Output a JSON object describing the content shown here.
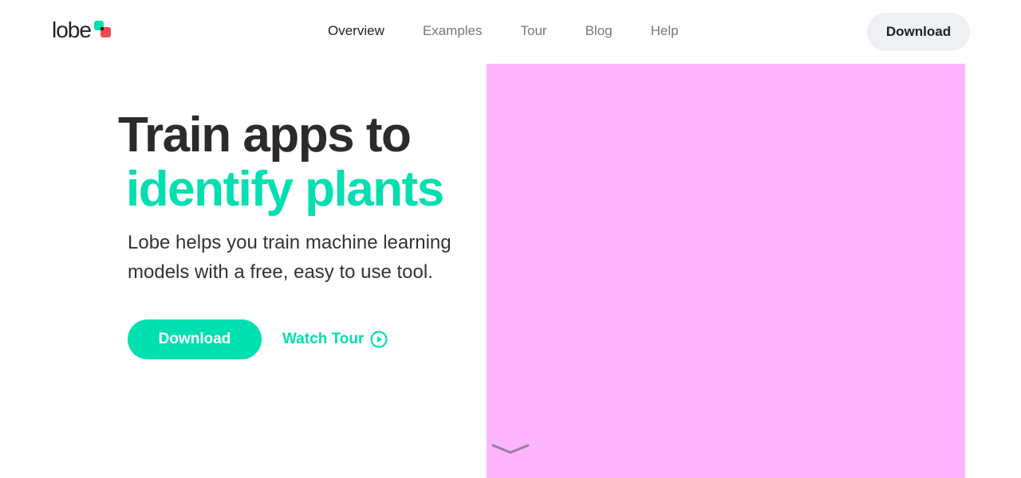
{
  "brand": {
    "name": "lobe",
    "colors": {
      "accent": "#00dfb0",
      "secondary": "#f04a55",
      "media_panel": "#ffb4ff"
    }
  },
  "nav": {
    "items": [
      {
        "label": "Overview",
        "active": true
      },
      {
        "label": "Examples",
        "active": false
      },
      {
        "label": "Tour",
        "active": false
      },
      {
        "label": "Blog",
        "active": false
      },
      {
        "label": "Help",
        "active": false
      }
    ]
  },
  "header": {
    "download_label": "Download"
  },
  "hero": {
    "title_line1": "Train apps to",
    "title_line2": "identify plants",
    "subtitle": "Lobe helps you train machine learning models with a free, easy to use tool.",
    "download_label": "Download",
    "watch_tour_label": "Watch Tour",
    "watch_tour_icon": "play-circle-icon",
    "scroll_icon": "chevron-down-icon"
  }
}
